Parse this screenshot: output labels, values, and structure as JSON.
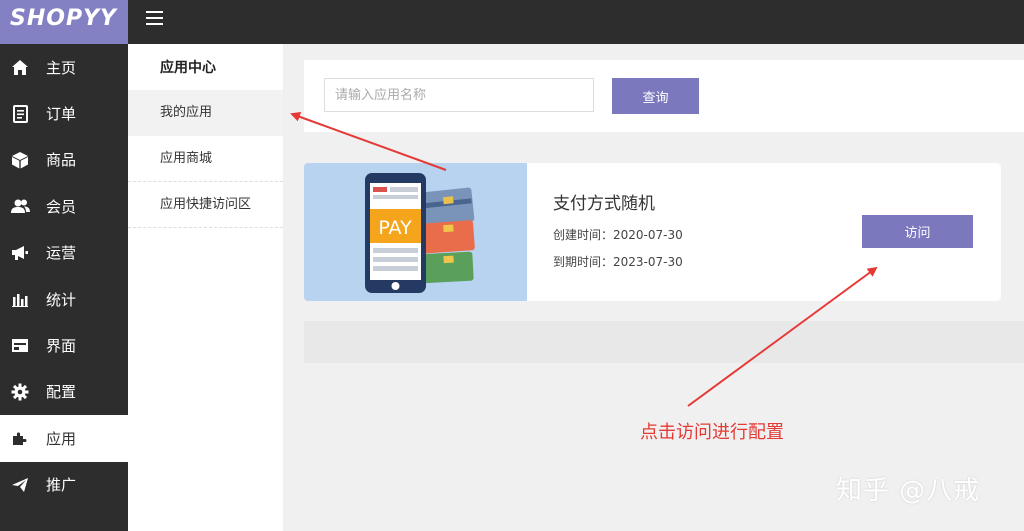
{
  "brand": {
    "logo": "SHOPYY"
  },
  "sidebar": {
    "items": [
      {
        "label": "主页",
        "icon": "home-icon"
      },
      {
        "label": "订单",
        "icon": "document-icon"
      },
      {
        "label": "商品",
        "icon": "box-icon"
      },
      {
        "label": "会员",
        "icon": "users-icon"
      },
      {
        "label": "运营",
        "icon": "megaphone-icon"
      },
      {
        "label": "统计",
        "icon": "bar-chart-icon"
      },
      {
        "label": "界面",
        "icon": "layout-icon"
      },
      {
        "label": "配置",
        "icon": "gear-icon"
      },
      {
        "label": "应用",
        "icon": "puzzle-icon",
        "active": true
      },
      {
        "label": "推广",
        "icon": "paper-plane-icon"
      }
    ]
  },
  "submenu": {
    "title": "应用中心",
    "items": [
      {
        "label": "我的应用",
        "active": true
      },
      {
        "label": "应用商城"
      },
      {
        "label": "应用快捷访问区"
      }
    ]
  },
  "search": {
    "placeholder": "请输入应用名称",
    "button": "查询"
  },
  "app": {
    "name": "支付方式随机",
    "created_label": "创建时间：",
    "created_value": "2020-07-30",
    "expires_label": "到期时间：",
    "expires_value": "2023-07-30",
    "visit_button": "访问",
    "thumb_text": "PAY"
  },
  "annotation": {
    "text": "点击访问进行配置"
  },
  "watermark": {
    "text": "知乎 @八戒"
  },
  "colors": {
    "accent": "#7b78be",
    "logo_bg": "#8480c4",
    "sidebar_bg": "#2d2d2d",
    "annotation": "#e53935",
    "thumb_bg": "#b7d3f0"
  }
}
